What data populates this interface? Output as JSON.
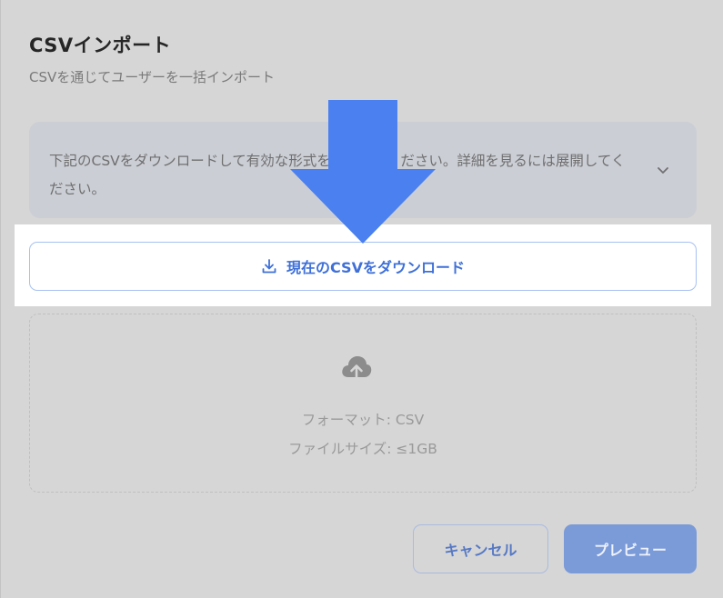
{
  "dialog": {
    "title": "CSVインポート",
    "subtitle": "CSVを通じてユーザーを一括インポート"
  },
  "info": {
    "text": "下記のCSVをダウンロードして有効な形式を確認してください。詳細を見るには展開してください。",
    "icon": "chevron-down-icon"
  },
  "download": {
    "label": "現在のCSVをダウンロード",
    "icon": "download-icon"
  },
  "dropzone": {
    "icon": "cloud-upload-icon",
    "format_text": "フォーマット: CSV",
    "size_text": "ファイルサイズ: ≤1GB"
  },
  "footer": {
    "cancel_label": "キャンセル",
    "preview_label": "プレビュー"
  },
  "annotation": {
    "arrow_color": "#4a80f0",
    "highlight_color": "#ffffff"
  }
}
